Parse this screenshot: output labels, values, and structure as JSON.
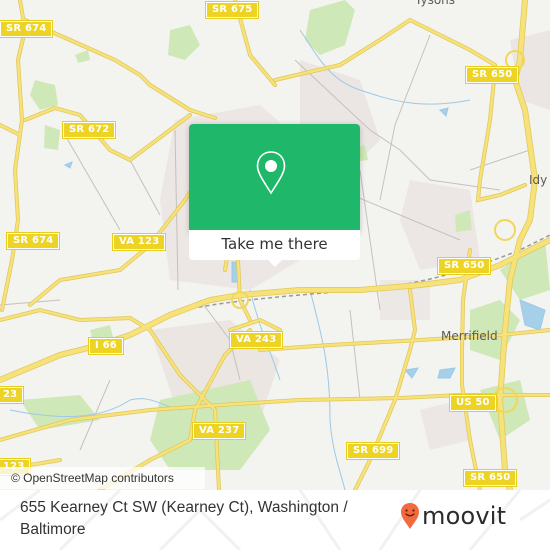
{
  "map": {
    "place_labels": [
      {
        "name": "tysons",
        "text": "Tysons"
      },
      {
        "name": "idylwood",
        "text": "Idy"
      },
      {
        "name": "merrifield",
        "text": "Merrifield"
      }
    ],
    "route_shields": [
      {
        "name": "sr-675",
        "text": "SR 675"
      },
      {
        "name": "sr-674-top",
        "text": "SR 674"
      },
      {
        "name": "sr-672",
        "text": "SR 672"
      },
      {
        "name": "sr-674-mid",
        "text": "SR 674"
      },
      {
        "name": "va-123-left",
        "text": "VA 123"
      },
      {
        "name": "sr-650-top",
        "text": "SR 650"
      },
      {
        "name": "sr-650-mid",
        "text": "SR 650"
      },
      {
        "name": "i-66",
        "text": "I 66"
      },
      {
        "name": "va-243",
        "text": "VA 243"
      },
      {
        "name": "va-123-edge1",
        "text": "23"
      },
      {
        "name": "va-237",
        "text": "VA 237"
      },
      {
        "name": "us-50",
        "text": "US 50"
      },
      {
        "name": "va-123-edge2",
        "text": "123"
      },
      {
        "name": "sr-699",
        "text": "SR 699"
      },
      {
        "name": "sr-650-bottom",
        "text": "SR 650"
      }
    ],
    "attribution": "© OpenStreetMap contributors"
  },
  "popup": {
    "icon": "map-pin-icon",
    "button_label": "Take me there",
    "accent_color": "#1fb86a"
  },
  "footer": {
    "address": "655 Kearney Ct SW (Kearney Ct), Washington / Baltimore",
    "brand": {
      "icon": "moovit-pin-icon",
      "wordmark": "moovit",
      "icon_color": "#f26a3d"
    }
  }
}
